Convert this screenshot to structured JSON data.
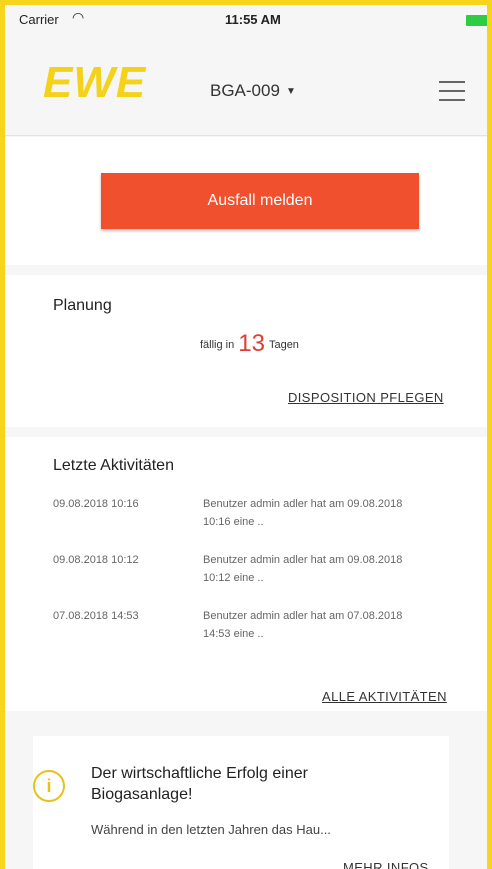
{
  "status_bar": {
    "carrier": "Carrier",
    "time": "11:55 AM"
  },
  "header": {
    "logo": "EWE",
    "device_select": "BGA-009",
    "menu_icon": "hamburger-menu-icon"
  },
  "actions": {
    "report_failure": "Ausfall melden"
  },
  "planning": {
    "title": "Planung",
    "due_prefix": "fällig in",
    "due_days": "13",
    "due_suffix": "Tagen",
    "link": "DISPOSITION PFLEGEN"
  },
  "activities": {
    "title": "Letzte Aktivitäten",
    "items": [
      {
        "date": "09.08.2018 10:16",
        "text": "Benutzer admin adler hat am 09.08.2018 10:16 eine .."
      },
      {
        "date": "09.08.2018 10:12",
        "text": "Benutzer admin adler hat am 09.08.2018 10:12 eine .."
      },
      {
        "date": "07.08.2018 14:53",
        "text": "Benutzer admin adler hat am 07.08.2018 14:53 eine .."
      }
    ],
    "link": "ALLE AKTIVITÄTEN"
  },
  "info": {
    "icon": "info-icon",
    "title": "Der wirtschaftliche Erfolg einer Biogasanlage!",
    "text": "Während in den letzten Jahren das Hau...",
    "link": "MEHR INFOS"
  },
  "colors": {
    "brand_yellow": "#f4d21a",
    "alert_red": "#f0502e",
    "due_red": "#e03c31"
  }
}
